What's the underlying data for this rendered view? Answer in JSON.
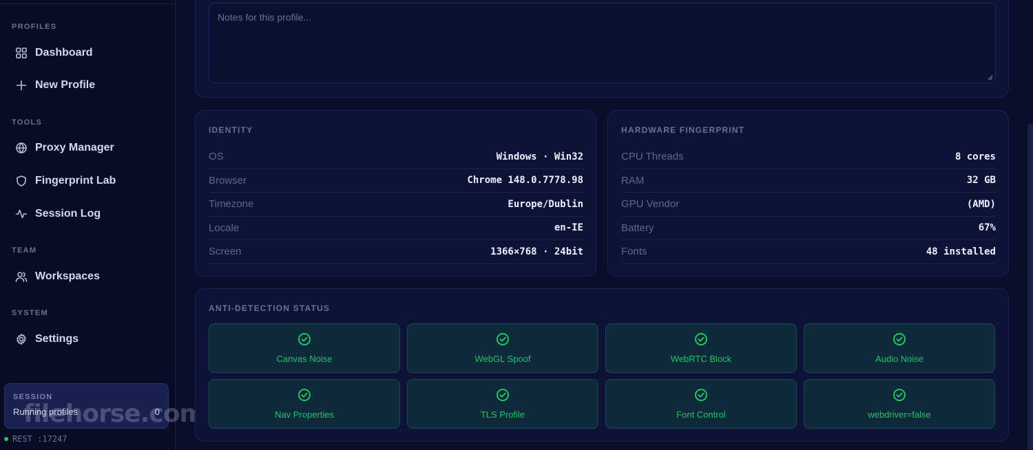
{
  "sidebar": {
    "sections": {
      "profiles": "PROFILES",
      "tools": "TOOLS",
      "team": "TEAM",
      "system": "SYSTEM"
    },
    "items": {
      "dashboard": "Dashboard",
      "new_profile": "New Profile",
      "proxy_manager": "Proxy Manager",
      "fingerprint_lab": "Fingerprint Lab",
      "session_log": "Session Log",
      "workspaces": "Workspaces",
      "settings": "Settings"
    },
    "session": {
      "heading": "SESSION",
      "label": "Running profiles",
      "count": "0"
    },
    "status": "REST :17247",
    "watermark": "filehorse.com"
  },
  "notes": {
    "placeholder": "Notes for this profile..."
  },
  "identity": {
    "heading": "IDENTITY",
    "rows": [
      {
        "key": "OS",
        "value": "Windows · Win32"
      },
      {
        "key": "Browser",
        "value": "Chrome 148.0.7778.98"
      },
      {
        "key": "Timezone",
        "value": "Europe/Dublin"
      },
      {
        "key": "Locale",
        "value": "en-IE"
      },
      {
        "key": "Screen",
        "value": "1366×768 · 24bit"
      }
    ]
  },
  "hardware": {
    "heading": "HARDWARE FINGERPRINT",
    "rows": [
      {
        "key": "CPU Threads",
        "value": "8 cores"
      },
      {
        "key": "RAM",
        "value": "32 GB"
      },
      {
        "key": "GPU Vendor",
        "value": "(AMD)"
      },
      {
        "key": "Battery",
        "value": "67%"
      },
      {
        "key": "Fonts",
        "value": "48 installed"
      }
    ]
  },
  "anti_detection": {
    "heading": "ANTI-DETECTION STATUS",
    "items": [
      "Canvas Noise",
      "WebGL Spoof",
      "WebRTC Block",
      "Audio Noise",
      "Nav Properties",
      "TLS Profile",
      "Font Control",
      "webdriver=false"
    ]
  },
  "colors": {
    "background": "#0a0e2a",
    "card": "#0d1236",
    "accent_green": "#22c55e",
    "tile_bg": "#0f2a3d"
  }
}
